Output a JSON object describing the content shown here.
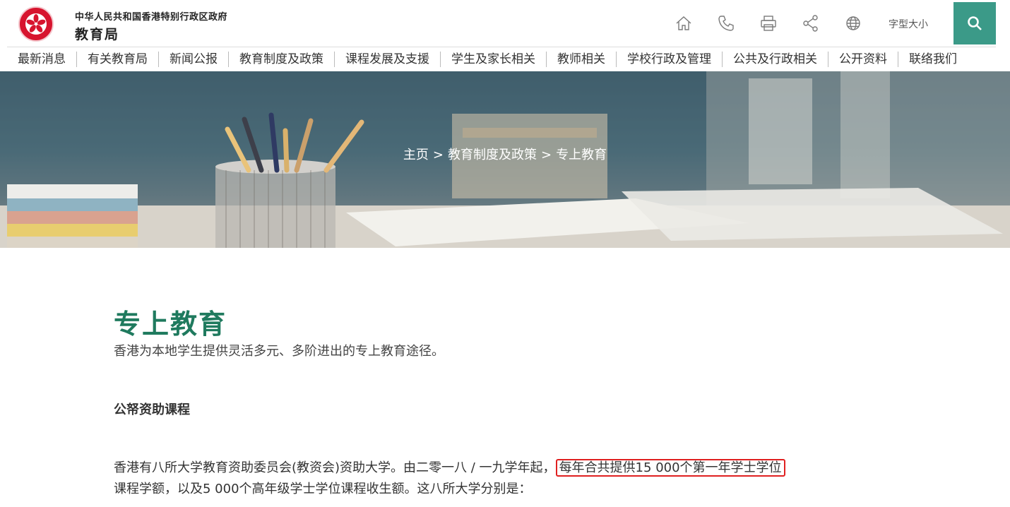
{
  "header": {
    "gov_name": "中华人民共和国香港特别行政区政府",
    "bureau_name": "教育局",
    "font_size_label": "字型大小",
    "icons": [
      "home-icon",
      "phone-icon",
      "print-icon",
      "share-icon",
      "globe-icon",
      "search-icon"
    ],
    "accent_color": "#3b9a88"
  },
  "nav": {
    "items": [
      {
        "label": "最新消息"
      },
      {
        "label": "有关教育局"
      },
      {
        "label": "新闻公报"
      },
      {
        "label": "教育制度及政策"
      },
      {
        "label": "课程发展及支援"
      },
      {
        "label": "学生及家长相关"
      },
      {
        "label": "教师相关"
      },
      {
        "label": "学校行政及管理"
      },
      {
        "label": "公共及行政相关"
      },
      {
        "label": "公开资料"
      },
      {
        "label": "联络我们"
      }
    ]
  },
  "breadcrumb": {
    "home": "主页",
    "parent": "教育制度及政策",
    "current": "专上教育",
    "separator": ">"
  },
  "content": {
    "title": "专上教育",
    "subtitle": "香港为本地学生提供灵活多元、多阶进出的专上教育途径。",
    "section_heading": "公帑资助课程",
    "para_part1": "香港有八所大学教育资助委员会(教资会)资助大学。由二零一八 / 一九学年起，",
    "para_highlight": "每年合共提供15 000个第一年学士学位",
    "para_part2": "课程学额，以及5 000个高年级学士学位课程收生额。这八所大学分别是："
  }
}
